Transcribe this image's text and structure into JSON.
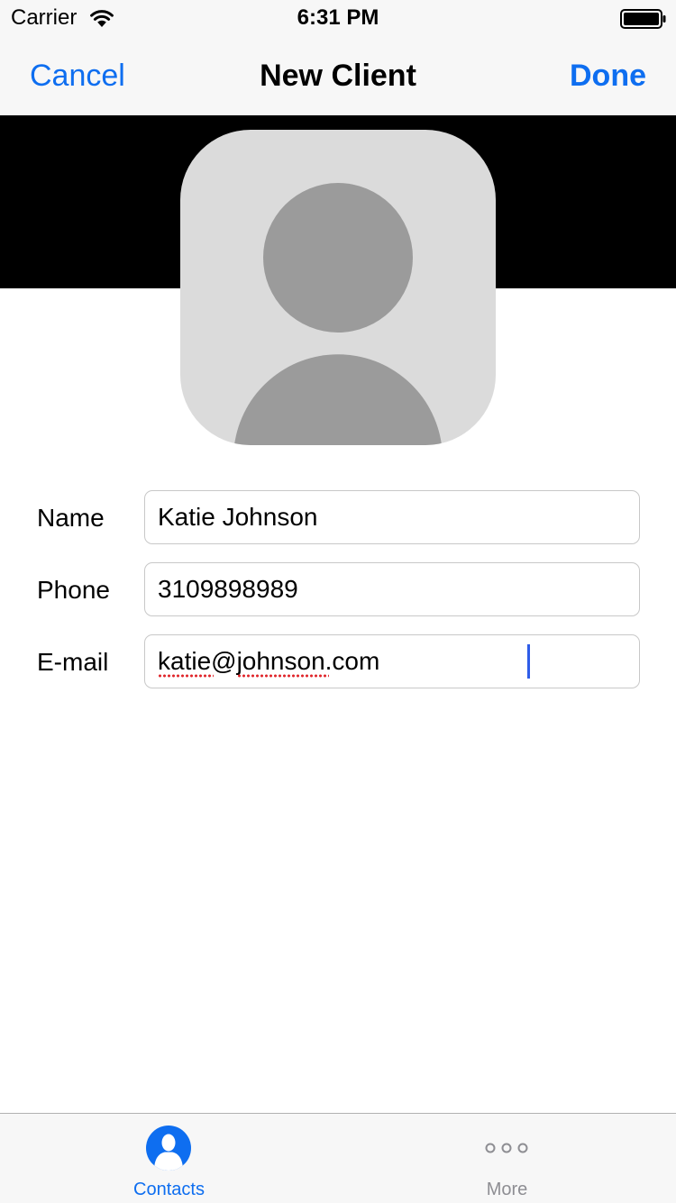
{
  "status_bar": {
    "carrier": "Carrier",
    "time": "6:31 PM",
    "wifi_icon": "wifi-icon",
    "battery_icon": "battery-full-icon",
    "battery_level": 1.0
  },
  "nav_bar": {
    "cancel_label": "Cancel",
    "title": "New Client",
    "done_label": "Done"
  },
  "avatar": {
    "icon": "person-placeholder-icon"
  },
  "form": {
    "name": {
      "label": "Name",
      "value": "Katie Johnson"
    },
    "phone": {
      "label": "Phone",
      "value": "3109898989"
    },
    "email": {
      "label": "E-mail",
      "value": "katie@johnson.com"
    }
  },
  "tab_bar": {
    "items": [
      {
        "label": "Contacts",
        "icon": "person-circle-icon",
        "selected": true
      },
      {
        "label": "More",
        "icon": "more-dots-icon",
        "selected": false
      }
    ]
  },
  "colors": {
    "accent": "#0e6ef0",
    "bar_background": "#f7f7f7",
    "header_band": "#000000",
    "avatar_background": "#dbdbdb",
    "avatar_figure": "#9b9b9b",
    "spellcheck": "#e0262b",
    "caret": "#2e5de8",
    "inactive_tab": "#8e8e93"
  }
}
